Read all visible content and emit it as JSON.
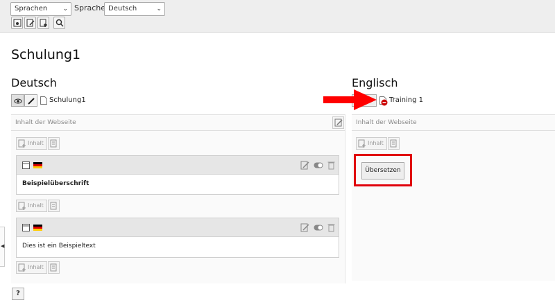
{
  "toolbar": {
    "view_select": "Sprachen",
    "language_label": "Sprache:",
    "language_select": "Deutsch",
    "buttons": [
      "view-page",
      "edit-page-properties",
      "new-page",
      "search"
    ]
  },
  "page_title": "Schulung1",
  "left": {
    "lang_title": "Deutsch",
    "page_name": "Schulung1",
    "column_header": "Inhalt der Webseite",
    "new_content_label": "Inhalt",
    "elements": [
      {
        "text": "Beispielüberschrift",
        "bold": true
      },
      {
        "text": "Dies ist ein Beispieltext",
        "bold": false
      }
    ]
  },
  "right": {
    "lang_title": "Englisch",
    "page_name": "Training 1",
    "column_header": "Inhalt der Webseite",
    "new_content_label": "Inhalt",
    "translate_button": "Übersetzen"
  },
  "help_label": "?",
  "colors": {
    "highlight_red": "#e0000b",
    "arrow_red": "#ff0000"
  }
}
